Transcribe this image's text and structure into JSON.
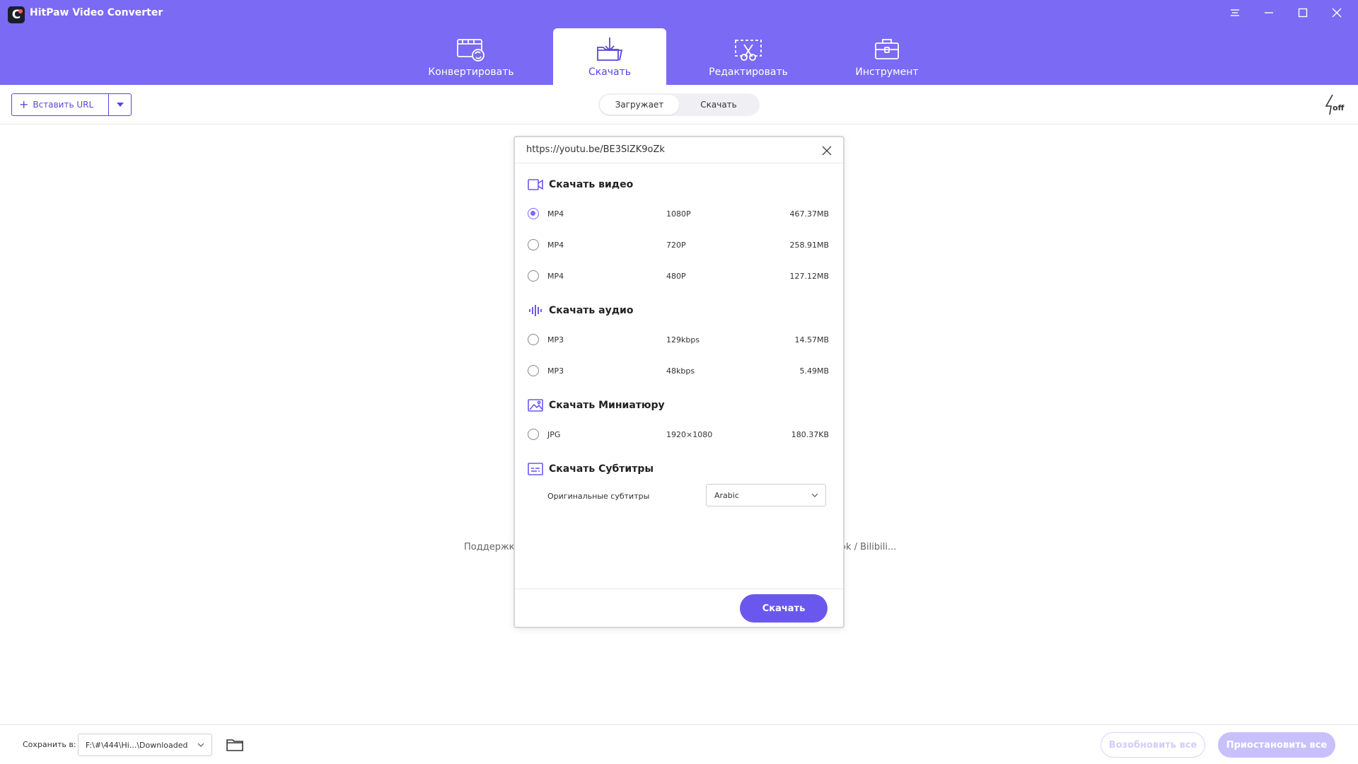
{
  "app": {
    "title": "HitPaw Video Converter"
  },
  "tabs": [
    {
      "label": "Конвертировать",
      "icon": "film-convert-icon"
    },
    {
      "label": "Скачать",
      "icon": "download-folder-icon"
    },
    {
      "label": "Редактировать",
      "icon": "edit-crop-icon"
    },
    {
      "label": "Инструмент",
      "icon": "toolbox-icon"
    }
  ],
  "toolbar": {
    "paste_url": "Вставить URL",
    "segments": [
      "Загружает",
      "Скачать"
    ],
    "turbo_label": "off"
  },
  "background": {
    "support_left": "Поддержка",
    "support_right": "ok / Bilibili..."
  },
  "dialog": {
    "url": "https://youtu.be/BE3SlZK9oZk",
    "video_title": "Скачать видео",
    "video_options": [
      {
        "format": "MP4",
        "quality": "1080P",
        "size": "467.37MB"
      },
      {
        "format": "MP4",
        "quality": "720P",
        "size": "258.91MB"
      },
      {
        "format": "MP4",
        "quality": "480P",
        "size": "127.12MB"
      }
    ],
    "audio_title": "Скачать аудио",
    "audio_options": [
      {
        "format": "MP3",
        "quality": "129kbps",
        "size": "14.57MB"
      },
      {
        "format": "MP3",
        "quality": "48kbps",
        "size": "5.49MB"
      }
    ],
    "thumb_title": "Скачать Миниатюру",
    "thumb_options": [
      {
        "format": "JPG",
        "quality": "1920×1080",
        "size": "180.37KB"
      }
    ],
    "subs_title": "Скачать Субтитры",
    "subs_label": "Оригинальные субтитры",
    "subs_value": "Arabic",
    "download_btn": "Скачать"
  },
  "footer": {
    "save_label": "Сохранить в:",
    "save_path": "F:\\#\\444\\Hi...\\Downloaded",
    "resume_all": "Возобновить все",
    "pause_all": "Приостановить все"
  },
  "colors": {
    "accent": "#7a6af4",
    "button": "#6a58ee",
    "active_tab_text": "#5848d8"
  }
}
